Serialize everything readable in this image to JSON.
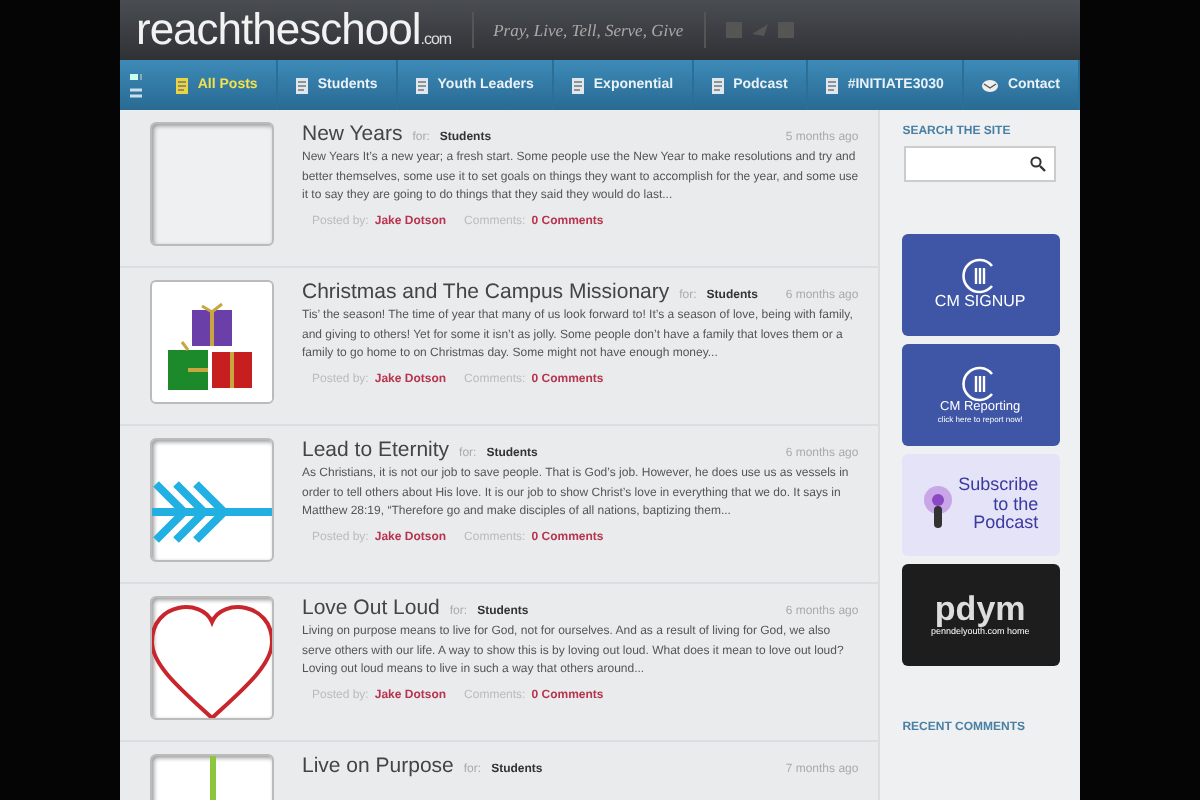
{
  "header": {
    "logo": "reachtheschool",
    "logo_suffix": ".com",
    "tagline": "Pray, Live, Tell, Serve, Give"
  },
  "nav": [
    {
      "label": "All Posts",
      "selected": true
    },
    {
      "label": "Students",
      "selected": false
    },
    {
      "label": "Youth Leaders",
      "selected": false
    },
    {
      "label": "Exponential",
      "selected": false
    },
    {
      "label": "Podcast",
      "selected": false
    },
    {
      "label": "#INITIATE3030",
      "selected": false
    },
    {
      "label": "Contact",
      "selected": false,
      "kind": "mail"
    }
  ],
  "posts": [
    {
      "title": "New Years",
      "for_label": "for:",
      "category": "Students",
      "age": "5 months ago",
      "kind": "blank",
      "excerpt": "New Years It’s a new year; a fresh start. Some people use the New Year to make resolutions and try and better themselves, some use it to set goals on things they want to accomplish for the year, and some use it to say they are going to do things that they said they would do last...",
      "posted_label": "Posted by:",
      "author": "Jake Dotson",
      "comments_label": "Comments:",
      "comments": "0 Comments"
    },
    {
      "title": "Christmas and The Campus Missionary",
      "for_label": "for:",
      "category": "Students",
      "age": "6 months ago",
      "kind": "picture",
      "excerpt": "Tis’ the season! The time of year that many of us look forward to! It’s a season of love, being with family, and giving to others! Yet for some it isn’t as jolly. Some people don’t have a family that loves them or a family to go home to on Christmas day. Some might not have enough money...",
      "posted_label": "Posted by:",
      "author": "Jake Dotson",
      "comments_label": "Comments:",
      "comments": "0 Comments"
    },
    {
      "title": "Lead to Eternity",
      "for_label": "for:",
      "category": "Students",
      "age": "6 months ago",
      "kind": "arrows",
      "excerpt": "As Christians, it is not our job to save people. That is God’s job. However, he does use us as vessels in order to tell others about His love. It is our job to show Christ’s love in everything that we do.  It says in Matthew 28:19, “Therefore go and make disciples of all nations, baptizing them...",
      "posted_label": "Posted by:",
      "author": "Jake Dotson",
      "comments_label": "Comments:",
      "comments": "0 Comments"
    },
    {
      "title": "Love Out Loud",
      "for_label": "for:",
      "category": "Students",
      "age": "6 months ago",
      "kind": "heart",
      "excerpt": "Living on purpose means to live for God, not for ourselves. And as a result of living for God, we also serve others with our life. A way to show this is by loving out loud. What does it mean to love out loud? Loving out loud means to live in such a way that others around...",
      "posted_label": "Posted by:",
      "author": "Jake Dotson",
      "comments_label": "Comments:",
      "comments": "0 Comments"
    },
    {
      "title": "Live on Purpose",
      "for_label": "for:",
      "category": "Students",
      "age": "7 months ago",
      "kind": "line"
    }
  ],
  "sidebar": {
    "search_heading": "SEARCH THE SITE",
    "banners": [
      {
        "kind": "cm",
        "lines": [
          "CM SIGNUP"
        ]
      },
      {
        "kind": "cm",
        "lines": [
          "CM Reporting",
          "click here to report now!"
        ]
      },
      {
        "kind": "podcast",
        "lines": [
          "Subscribe",
          "to the",
          "Podcast"
        ]
      },
      {
        "kind": "pdym",
        "lines": [
          "pdym",
          "penndelyouth.com home"
        ]
      }
    ],
    "comments_heading": "RECENT COMMENTS"
  }
}
